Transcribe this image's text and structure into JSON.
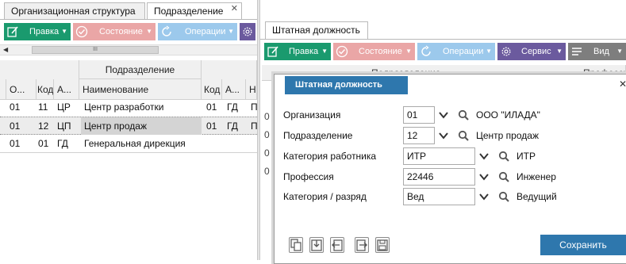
{
  "left_tabs": [
    {
      "label": "Организационная структура"
    },
    {
      "label": "Подразделение"
    }
  ],
  "left_toolbar": {
    "edit_label": "Правка",
    "state_label": "Состояние",
    "ops_label": "Операции"
  },
  "left_scroll": {
    "thumb_glyph": "III"
  },
  "left_table": {
    "group_header": "Подразделение",
    "columns": [
      "О...",
      "Код",
      "А...",
      "Наименование",
      "Код",
      "А...",
      "Н"
    ],
    "rows": [
      {
        "c1": "01",
        "c2": "11",
        "c3": "ЦР",
        "c4": "Центр разработки",
        "c5": "01",
        "c6": "ГД",
        "c7": "П"
      },
      {
        "c1": "01",
        "c2": "12",
        "c3": "ЦП",
        "c4": "Центр продаж",
        "c5": "01",
        "c6": "ГД",
        "c7": "П"
      },
      {
        "c1": "01",
        "c2": "01",
        "c3": "ГД",
        "c4": "Генеральная дирекция",
        "c5": "",
        "c6": "",
        "c7": ""
      }
    ]
  },
  "right_tab": {
    "label": "Штатная должность"
  },
  "right_toolbar": {
    "edit_label": "Правка",
    "state_label": "Состояние",
    "ops_label": "Операции",
    "service_label": "Сервис",
    "view_label": "Вид"
  },
  "right_grid": {
    "header_partial_1": "Подразделение",
    "header_partial_2": "Профессия",
    "row_partial": "0"
  },
  "dialog": {
    "title": "Штатная должность",
    "fields": [
      {
        "label": "Организация",
        "value": "01",
        "description": "ООО \"ИЛАДА\""
      },
      {
        "label": "Подразделение",
        "value": "12",
        "description": "Центр продаж"
      },
      {
        "label": "Категория работника",
        "value": "ИТР",
        "description": "ИТР"
      },
      {
        "label": "Профессия",
        "value": "22446",
        "description": "Инженер"
      },
      {
        "label": "Категория / разряд",
        "value": "Вед",
        "description": "Ведущий"
      }
    ],
    "save_label": "Сохранить"
  },
  "colors": {
    "green": "#1a9a6e",
    "pink": "#eaa6a6",
    "light_blue": "#9cc9ec",
    "purple": "#6b5a9e",
    "dialog_title_bg": "#2e77ad",
    "save_bg": "#2e77ad",
    "selected_row": "#d4d4d4"
  }
}
